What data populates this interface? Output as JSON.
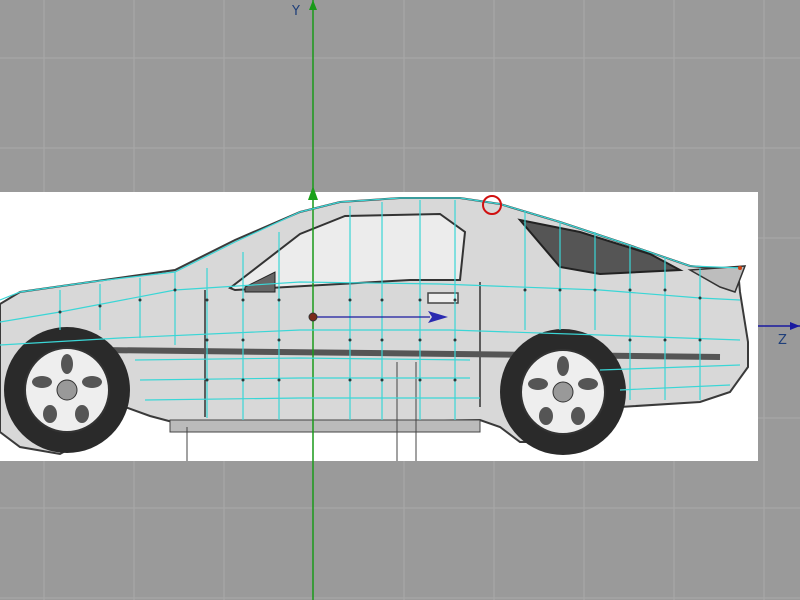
{
  "viewport": {
    "axis_y_label": "Y",
    "axis_z_label": "Z",
    "colors": {
      "background": "#9a9a9a",
      "grid_line": "#a8a8a8",
      "y_axis": "#1a9a1a",
      "z_axis": "#1a1aa0",
      "wireframe": "#3ad6d6",
      "vertex": "#2a3a3a",
      "pivot": "#7a2a1a",
      "selection_ring": "#d01010"
    },
    "icons": {
      "y_arrow": "arrow-up-icon",
      "z_arrow": "arrow-right-icon",
      "move_gizmo": "move-arrow-icon",
      "selection": "circle-selection-icon"
    }
  }
}
